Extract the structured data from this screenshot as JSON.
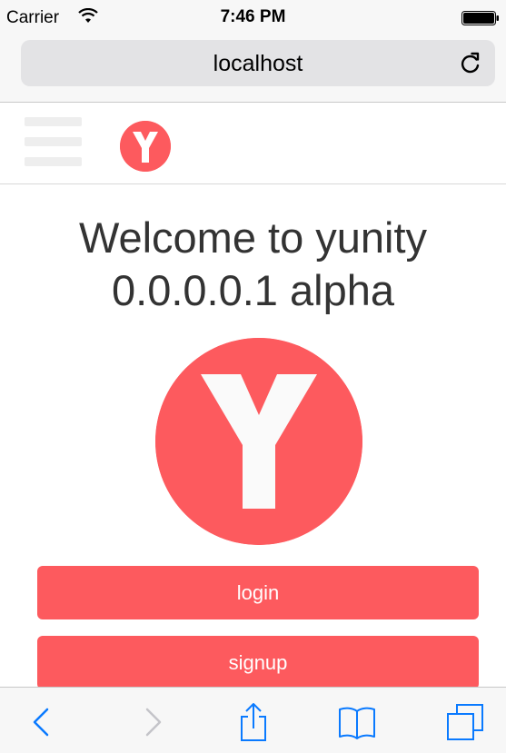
{
  "status_bar": {
    "carrier": "Carrier",
    "time": "7:46 PM",
    "icons": [
      "wifi-icon",
      "battery-icon"
    ]
  },
  "url_bar": {
    "url": "localhost",
    "icons": [
      "reload-icon"
    ]
  },
  "app_header": {
    "icons": [
      "hamburger-menu-icon",
      "yunity-logo-icon"
    ],
    "logo_letter": "Y"
  },
  "main": {
    "title_line1": "Welcome to yunity",
    "title_line2": "0.0.0.0.1 alpha",
    "logo_letter": "Y",
    "login_label": "login",
    "signup_label": "signup"
  },
  "toolbar": {
    "icons": [
      "back-icon",
      "forward-icon",
      "share-icon",
      "bookmarks-icon",
      "tabs-icon"
    ]
  },
  "colors": {
    "brand": "#fd5a5e",
    "ios_blue": "#0a7aff",
    "disabled": "#c4c4c9",
    "title_text": "#333333",
    "bar_bg": "#f7f7f7",
    "url_field_bg": "#e3e3e5"
  }
}
